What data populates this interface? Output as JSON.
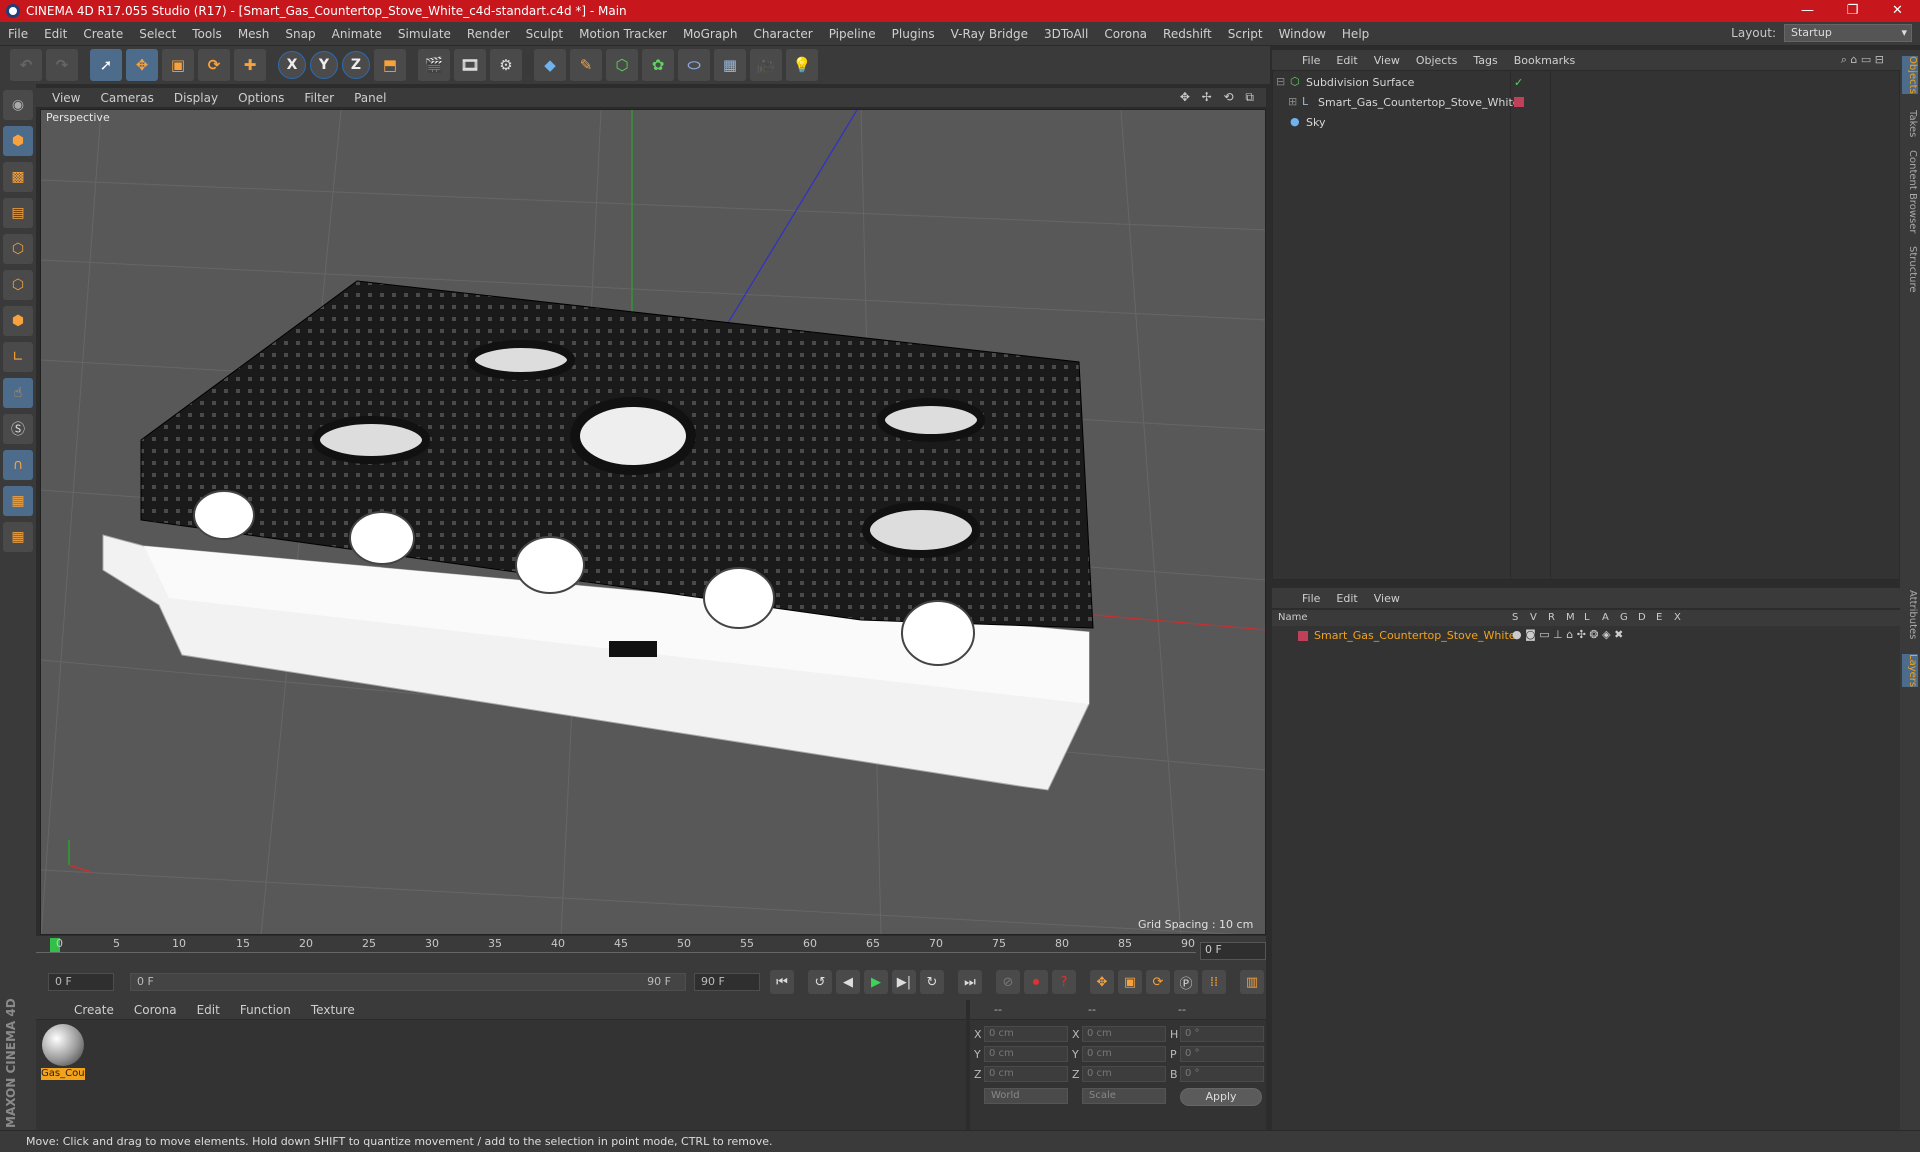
{
  "window": {
    "title": "CINEMA 4D R17.055 Studio (R17) - [Smart_Gas_Countertop_Stove_White_c4d-standart.c4d *] - Main",
    "minimize": "—",
    "restore": "❐",
    "close": "✕"
  },
  "menubar": {
    "items": [
      "File",
      "Edit",
      "Create",
      "Select",
      "Tools",
      "Mesh",
      "Snap",
      "Animate",
      "Simulate",
      "Render",
      "Sculpt",
      "Motion Tracker",
      "MoGraph",
      "Character",
      "Pipeline",
      "Plugins",
      "V-Ray Bridge",
      "3DToAll",
      "Corona",
      "Redshift",
      "Script",
      "Window",
      "Help"
    ],
    "layout_label": "Layout:",
    "layout_value": "Startup"
  },
  "toolbar": {
    "axis_x": "X",
    "axis_y": "Y",
    "axis_z": "Z"
  },
  "viewport": {
    "menu": [
      "View",
      "Cameras",
      "Display",
      "Options",
      "Filter",
      "Panel"
    ],
    "nav_icons": "✥ ✢ ⟲ ⧉",
    "camera_label": "Perspective",
    "grid_spacing": "Grid Spacing : 10 cm"
  },
  "timeline": {
    "ticks": [
      "0",
      "5",
      "10",
      "15",
      "20",
      "25",
      "30",
      "35",
      "40",
      "45",
      "50",
      "55",
      "60",
      "65",
      "70",
      "75",
      "80",
      "85",
      "90"
    ],
    "current_frame": "0 F",
    "start_frame": "0 F",
    "range_start": "0 F",
    "range_end": "90 F",
    "end_frame": "90 F"
  },
  "material_manager": {
    "menu": [
      "Create",
      "Corona",
      "Edit",
      "Function",
      "Texture"
    ],
    "material_name": "Gas_Cou"
  },
  "branding": "MAXON CINEMA 4D",
  "coordinates": {
    "headers": [
      "--",
      "--",
      "--"
    ],
    "labels_pos": [
      "X",
      "Y",
      "Z"
    ],
    "labels_size": [
      "X",
      "Y",
      "Z"
    ],
    "labels_rot": [
      "H",
      "P",
      "B"
    ],
    "pos": [
      "0 cm",
      "0 cm",
      "0 cm"
    ],
    "size": [
      "0 cm",
      "0 cm",
      "0 cm"
    ],
    "rot": [
      "0 °",
      "0 °",
      "0 °"
    ],
    "world": "World",
    "scale": "Scale",
    "apply": "Apply"
  },
  "status": "Move: Click and drag to move elements. Hold down SHIFT to quantize movement / add to the selection in point mode, CTRL to remove.",
  "object_manager": {
    "menu": [
      "File",
      "Edit",
      "View",
      "Objects",
      "Tags",
      "Bookmarks"
    ],
    "objects": [
      "Subdivision Surface",
      "Smart_Gas_Countertop_Stove_White",
      "Sky"
    ]
  },
  "layer_manager": {
    "menu": [
      "File",
      "Edit",
      "View"
    ],
    "columns": [
      "Name",
      "S",
      "V",
      "R",
      "M",
      "L",
      "A",
      "G",
      "D",
      "E",
      "X"
    ],
    "layers": [
      "Smart_Gas_Countertop_Stove_White"
    ]
  },
  "right_tabs": [
    "Objects",
    "Takes",
    "Content Browser",
    "Structure",
    "Attributes",
    "Layers"
  ],
  "colors": {
    "titlebar": "#c8161d",
    "accent": "#f2a31b",
    "layer_color": "#c0405a"
  }
}
